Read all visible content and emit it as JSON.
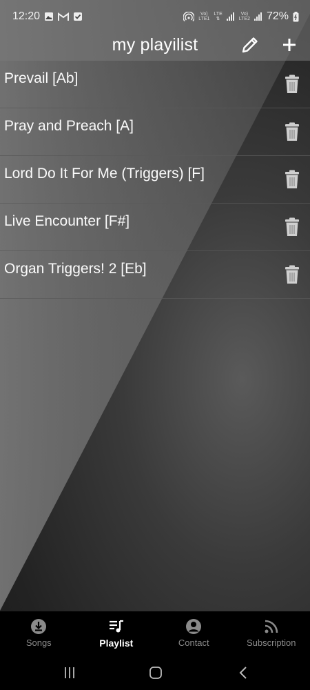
{
  "status_bar": {
    "time": "12:20",
    "battery": "72%",
    "sim1_top": "Vo)",
    "sim1_bottom": "LTE1",
    "lte_label": "LTE",
    "sim2_top": "Vo)",
    "sim2_bottom": "LTE2",
    "icons": [
      "image-icon",
      "gmail-icon",
      "checkbox-icon",
      "hotspot-icon",
      "signal-icon",
      "battery-icon"
    ]
  },
  "app_bar": {
    "title": "my playilist",
    "icons": [
      "pencil-icon",
      "plus-icon"
    ]
  },
  "playlist": {
    "items": [
      {
        "title": "Prevail [Ab]"
      },
      {
        "title": "Pray and Preach [A]"
      },
      {
        "title": "Lord Do It For Me (Triggers) [F]"
      },
      {
        "title": "Live Encounter [F#]"
      },
      {
        "title": "Organ Triggers! 2 [Eb]"
      }
    ]
  },
  "bottom_nav": {
    "items": [
      {
        "label": "Songs",
        "icon": "download-circle-icon"
      },
      {
        "label": "Playlist",
        "icon": "playlist-music-icon"
      },
      {
        "label": "Contact",
        "icon": "account-circle-icon"
      },
      {
        "label": "Subscription",
        "icon": "rss-icon"
      }
    ],
    "active": "Playlist"
  },
  "system_nav": {
    "icons": [
      "recents-icon",
      "home-icon",
      "back-icon"
    ]
  },
  "colors": {
    "text": "#ffffff",
    "inactive_nav": "#8a8a8a",
    "nav_background": "#000000",
    "divider": "#5a5a5a"
  }
}
